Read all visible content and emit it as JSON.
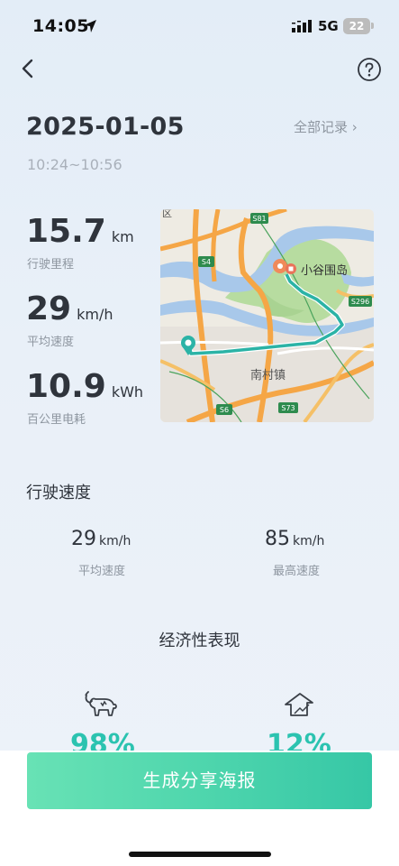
{
  "status_bar": {
    "time": "14:05",
    "network": "5G",
    "battery": "22"
  },
  "header": {
    "back_icon": "chevron-left-icon",
    "help_icon": "question-circle-icon"
  },
  "trip": {
    "date": "2025-01-05",
    "all_records_label": "全部记录 ›",
    "time_range": "10:24~10:56"
  },
  "stats": [
    {
      "value": "15.7",
      "unit": "km",
      "label": "行驶里程"
    },
    {
      "value": "29",
      "unit": "km/h",
      "label": "平均速度"
    },
    {
      "value": "10.9",
      "unit": "kWh",
      "label": "百公里电耗"
    }
  ],
  "map": {
    "labels": {
      "district_fragment": "区",
      "island": "小谷围岛",
      "town": "南村镇"
    },
    "road_shields": [
      "S81",
      "S4",
      "S296",
      "S6",
      "S73"
    ],
    "route_color": "#2bb3a6"
  },
  "driving_speed": {
    "title": "行驶速度",
    "avg": {
      "value": "29",
      "unit": "km/h",
      "label": "平均速度"
    },
    "max": {
      "value": "85",
      "unit": "km/h",
      "label": "最高速度"
    }
  },
  "economy": {
    "title": "经济性表现",
    "left": {
      "icon": "bull-icon",
      "value": "98%"
    },
    "right": {
      "icon": "house-up-icon",
      "value": "12%"
    }
  },
  "share_button_label": "生成分享海报",
  "colors": {
    "accent": "#2bc3b0",
    "button_start": "#68e2b5",
    "button_end": "#36c7a6"
  }
}
